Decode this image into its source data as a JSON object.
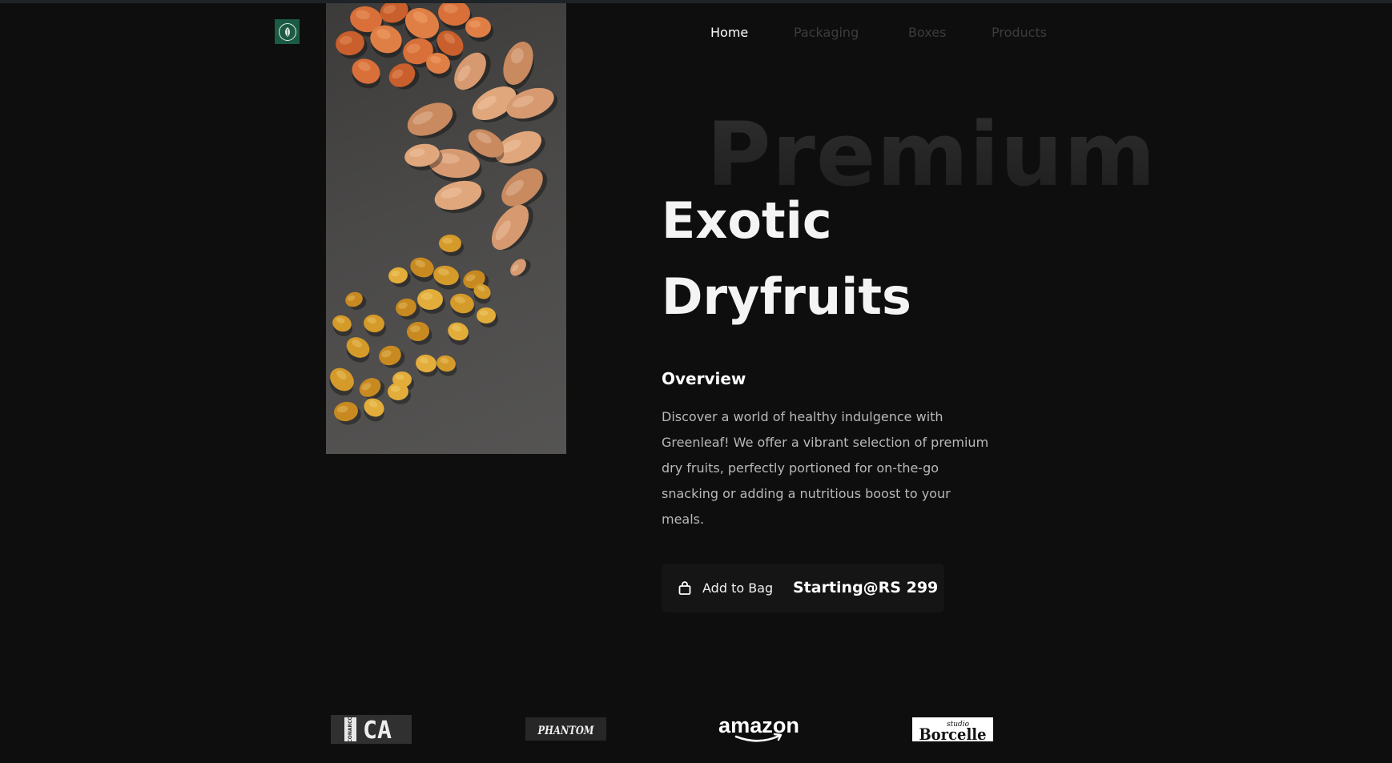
{
  "nav": {
    "items": [
      {
        "label": "Home",
        "active": true
      },
      {
        "label": "Packaging",
        "active": false
      },
      {
        "label": "Boxes",
        "active": false
      },
      {
        "label": "Products",
        "active": false
      }
    ]
  },
  "hero": {
    "background_word": "Premium",
    "title_line_1": "Exotic",
    "title_line_2": "Dryfruits",
    "overview_heading": "Overview",
    "overview_text": "Discover a world of healthy indulgence with Greenleaf! We offer a vibrant selection of premium dry fruits, perfectly portioned for on-the-go snacking or adding a nutritious boost to your meals.",
    "add_to_bag_label": "Add to Bag",
    "price_label": "Starting@RS 299"
  },
  "brands": [
    {
      "name": "CA",
      "small_text": "CONARCO"
    },
    {
      "name": "PHANTOM"
    },
    {
      "name": "amazon"
    },
    {
      "name": "Borcelle",
      "small_text": "studio"
    }
  ],
  "icons": {
    "logo": "leaf-icon",
    "cart": "shopping-bag-icon"
  },
  "colors": {
    "background": "#0e0e0e",
    "logo_green": "#1b5a43",
    "nav_active": "#ffffff",
    "nav_inactive": "#3c3c3c",
    "body_text": "#b9b9b9",
    "cta_background": "#151515"
  }
}
